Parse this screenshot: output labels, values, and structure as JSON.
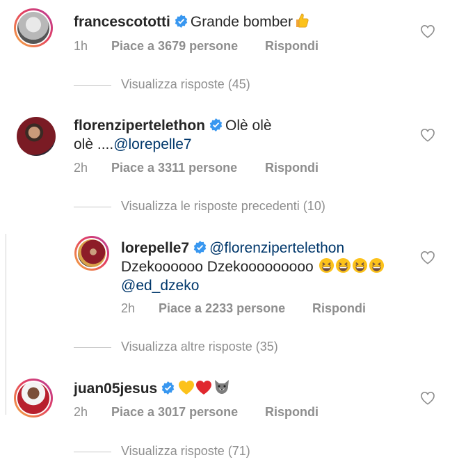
{
  "comments": [
    {
      "username": "francescototti",
      "text_before": "Grande bomber",
      "emojis": [
        "thumbs-up"
      ],
      "time": "1h",
      "likes": "Piace a 3679 persone",
      "reply": "Rispondi",
      "view_replies": "Visualizza risposte (45)"
    },
    {
      "username": "florenzipertelethon",
      "text": "Olè olè",
      "text_line2": "olè ....",
      "mention": "@lorepelle7",
      "time": "2h",
      "likes": "Piace a 3311 persone",
      "reply": "Rispondi",
      "view_replies": "Visualizza le risposte precedenti (10)"
    },
    {
      "username": "lorepelle7",
      "mention": "@florenzipertelethon",
      "text_line2": "Dzekoooooo Dzekooooooooo",
      "mention_line3": "@ed_dzeko",
      "emojis": [
        "grinning-squinting-face",
        "grinning-squinting-face",
        "grinning-squinting-face",
        "grinning-squinting-face"
      ],
      "time": "2h",
      "likes": "Piace a 2233 persone",
      "reply": "Rispondi",
      "view_replies": "Visualizza altre risposte (35)"
    },
    {
      "username": "juan05jesus",
      "emojis": [
        "yellow-heart",
        "red-heart",
        "wolf-face"
      ],
      "time": "2h",
      "likes": "Piace a 3017 persone",
      "reply": "Rispondi",
      "view_replies": "Visualizza risposte (71)"
    }
  ],
  "colors": {
    "text": "#262626",
    "meta": "#8e8e8e",
    "mention": "#00376b",
    "verified": "#3897f0"
  }
}
